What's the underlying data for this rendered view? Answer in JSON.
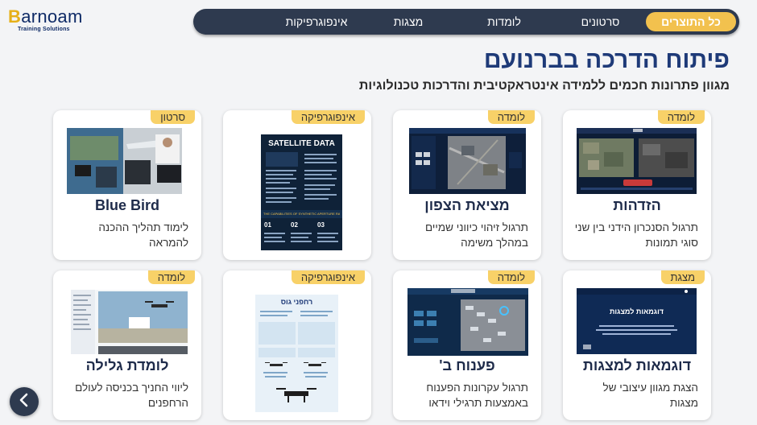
{
  "logo": {
    "word_lead": "B",
    "word_rest": "arnoam",
    "sub": "Training Solutions"
  },
  "nav": {
    "items": [
      {
        "label": "כל התוצרים",
        "active": true
      },
      {
        "label": "סרטונים",
        "active": false
      },
      {
        "label": "לומדות",
        "active": false
      },
      {
        "label": "מצגות",
        "active": false
      },
      {
        "label": "אינפוגרפיקות",
        "active": false
      }
    ]
  },
  "header": {
    "title": "פיתוח הדרכה בברנועם",
    "subtitle": "מגוון פתרונות חכמים ללמידה אינטראקטיבית והדרכות טכנולוגיות"
  },
  "cards": [
    {
      "badge": "לומדה",
      "title": "הזדהות",
      "desc": "תרגול הסנכרון הידני בין שני סוגי תמונות",
      "thumb": "satellite-comparison-screen"
    },
    {
      "badge": "לומדה",
      "title": "מציאת הצפון",
      "desc": "תרגול זיהוי כיווני שמיים במהלך משימה",
      "thumb": "aerial-orientation-screen"
    },
    {
      "badge": "אינפוגרפיקה",
      "title": "",
      "desc": "",
      "thumb": "satellite-data-infographic",
      "thumb_heading": "SATELLITE DATA",
      "thumb_subheading": "THE CAPABILITIES OF SYNTHETIC APERTURE RADAR (SAR)",
      "thumb_numbers": [
        "01",
        "02",
        "03"
      ]
    },
    {
      "badge": "סרטון",
      "title": "Blue Bird",
      "desc": "לימוד תהליך ההכנה להמראה",
      "thumb": "drone-operator-video"
    },
    {
      "badge": "מצגת",
      "title": "דוגמאות למצגות",
      "desc": "הצגת מגוון עיצובי של מצגות",
      "thumb": "presentation-sample",
      "thumb_heading": "דוגמאות למצגות"
    },
    {
      "badge": "לומדה",
      "title": "פענוח ב'",
      "desc": "תרגול עקרונות הפענוח באמצעות תרגילי וידאו",
      "thumb": "video-decoding-screen"
    },
    {
      "badge": "אינפוגרפיקה",
      "title": "",
      "desc": "",
      "thumb": "drones-infographic",
      "thumb_heading": "רחפני גוס"
    },
    {
      "badge": "לומדה",
      "title": "לומדת גלילה",
      "desc": "ליווי החניך בכניסה לעולם הרחפנים",
      "thumb": "drone-scroll-screen"
    }
  ],
  "icons": {
    "back": "chevron-left-icon"
  },
  "colors": {
    "nav_bg": "#2e3a4f",
    "accent": "#f2c14e",
    "badge": "#f8d168",
    "title": "#1e3a78",
    "background": "#f3f4f6"
  }
}
